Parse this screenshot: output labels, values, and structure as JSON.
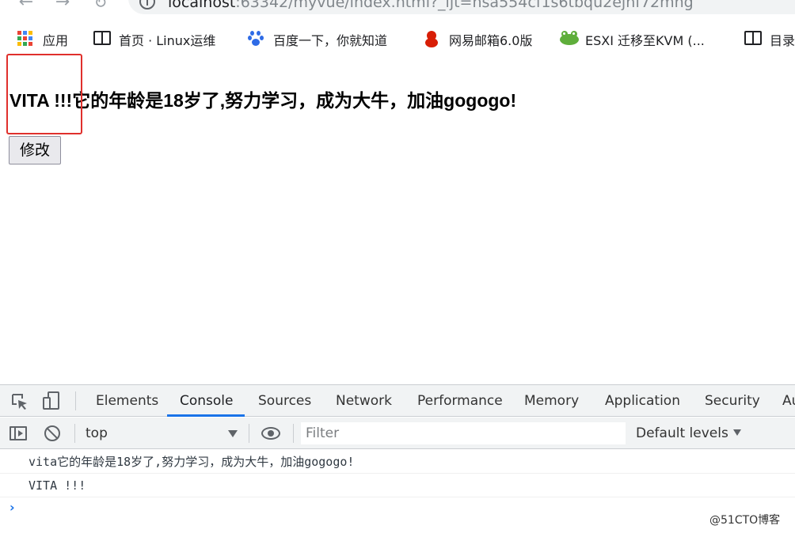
{
  "browser": {
    "url_host": "localhost",
    "url_rest": ":63342/myvue/index.html?_ijt=nsa554cf1s6tbqu2ejnf72mng"
  },
  "bookmarks": {
    "items": [
      {
        "label": "应用"
      },
      {
        "label": "首页 · Linux运维"
      },
      {
        "label": "百度一下，你就知道"
      },
      {
        "label": "网易邮箱6.0版"
      },
      {
        "label": "ESXI 迁移至KVM (..."
      },
      {
        "label": "目录"
      }
    ]
  },
  "page": {
    "headline": "VITA !!!它的年龄是18岁了,努力学习，成为大牛，加油gogogo!",
    "button_label": "修改"
  },
  "devtools": {
    "tabs": [
      {
        "label": "Elements"
      },
      {
        "label": "Console"
      },
      {
        "label": "Sources"
      },
      {
        "label": "Network"
      },
      {
        "label": "Performance"
      },
      {
        "label": "Memory"
      },
      {
        "label": "Application"
      },
      {
        "label": "Security"
      },
      {
        "label": "Au"
      }
    ],
    "active_tab": "Console",
    "context": "top",
    "filter_placeholder": "Filter",
    "levels_label": "Default levels",
    "accent_color": "#1a73e8",
    "logs": [
      "vita它的年龄是18岁了,努力学习，成为大牛，加油gogogo!",
      "VITA !!!"
    ],
    "prompt": "›"
  },
  "watermark": "@51CTO博客"
}
